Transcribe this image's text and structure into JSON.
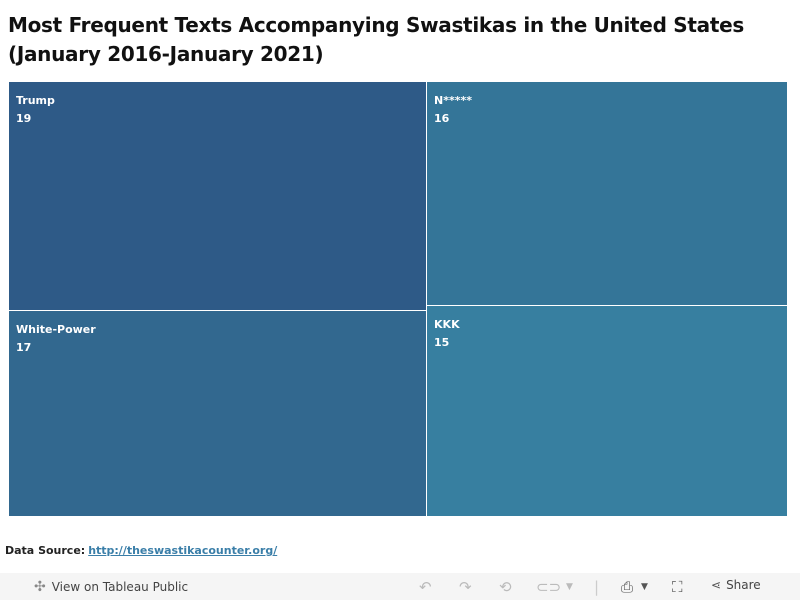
{
  "title": "Most Frequent Texts Accompanying Swastikas in the United States (January 2016-January 2021)",
  "chart_data": {
    "type": "treemap",
    "title": "Most Frequent Texts Accompanying Swastikas in the United States (January 2016-January 2021)",
    "items": [
      {
        "label": "Trump",
        "value": 19,
        "color": "#2e5a87"
      },
      {
        "label": "White-Power",
        "value": 17,
        "color": "#32688f"
      },
      {
        "label": "N*****",
        "value": 16,
        "color": "#347598"
      },
      {
        "label": "KKK",
        "value": 15,
        "color": "#377fa0"
      }
    ]
  },
  "source": {
    "label": "Data Source:",
    "link_text": "http://theswastikacounter.org/"
  },
  "footer": {
    "view_label": "View on Tableau Public",
    "share_label": "Share",
    "icons": [
      "tableau-logo-icon",
      "undo-icon",
      "redo-icon",
      "revert-icon",
      "refresh-icon",
      "download-icon",
      "fullscreen-icon",
      "share-icon"
    ]
  }
}
